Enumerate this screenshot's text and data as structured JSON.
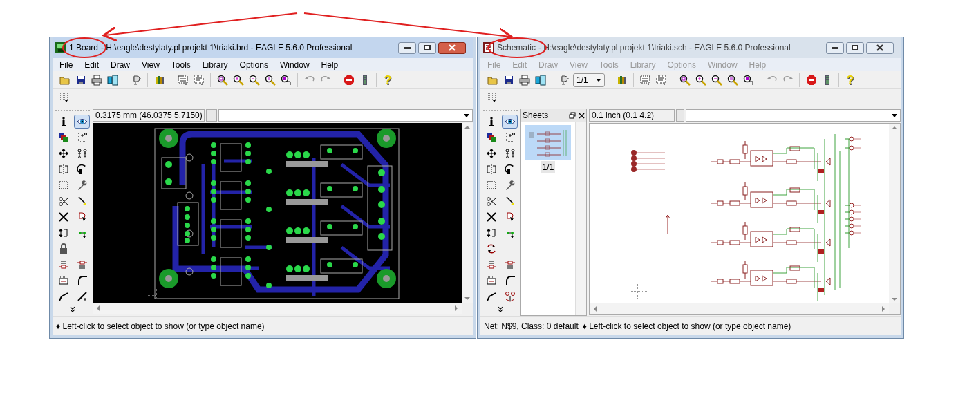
{
  "windows": [
    {
      "kind": "board",
      "active": true,
      "title_prefix": "1 Board",
      "title": "- H:\\eagle\\destylaty.pl projekt 1\\triaki.brd - EAGLE 5.6.0 Professional",
      "menu": [
        {
          "label": "File",
          "disabled": false
        },
        {
          "label": "Edit",
          "disabled": false
        },
        {
          "label": "Draw",
          "disabled": false
        },
        {
          "label": "View",
          "disabled": false
        },
        {
          "label": "Tools",
          "disabled": false
        },
        {
          "label": "Library",
          "disabled": false
        },
        {
          "label": "Options",
          "disabled": false
        },
        {
          "label": "Window",
          "disabled": false
        },
        {
          "label": "Help",
          "disabled": false
        }
      ],
      "toolbar": [
        {
          "kind": "open"
        },
        {
          "kind": "save"
        },
        {
          "kind": "print"
        },
        {
          "kind": "cam"
        },
        {
          "kind": "separator"
        },
        {
          "kind": "switch"
        },
        {
          "kind": "separator"
        },
        {
          "kind": "library"
        },
        {
          "kind": "separator"
        },
        {
          "kind": "script"
        },
        {
          "kind": "ulp"
        },
        {
          "kind": "separator"
        },
        {
          "kind": "zoomfit"
        },
        {
          "kind": "zoomin"
        },
        {
          "kind": "zoomout"
        },
        {
          "kind": "redraw"
        },
        {
          "kind": "zoomselect"
        },
        {
          "kind": "separator"
        },
        {
          "kind": "undo"
        },
        {
          "kind": "redo"
        },
        {
          "kind": "separator"
        },
        {
          "kind": "stop"
        },
        {
          "kind": "drc"
        },
        {
          "kind": "separator"
        },
        {
          "kind": "help",
          "label": "?"
        }
      ],
      "palette": [
        {
          "kind": "info",
          "selected": false
        },
        {
          "kind": "show",
          "selected": true
        },
        {
          "kind": "layers",
          "selected": false
        },
        {
          "kind": "mark",
          "selected": false
        },
        {
          "kind": "move",
          "selected": false
        },
        {
          "kind": "copy",
          "selected": false
        },
        {
          "kind": "mirror",
          "selected": false
        },
        {
          "kind": "rotate",
          "selected": false
        },
        {
          "kind": "group",
          "selected": false
        },
        {
          "kind": "change",
          "selected": false
        },
        {
          "kind": "cut",
          "selected": false
        },
        {
          "kind": "paste",
          "selected": false
        },
        {
          "kind": "delete",
          "selected": false
        },
        {
          "kind": "add",
          "selected": false
        },
        {
          "kind": "pinswap",
          "selected": false
        },
        {
          "kind": "gateswap",
          "selected": false
        },
        {
          "kind": "lock",
          "selected": false
        },
        {
          "kind": "name",
          "selected": false
        },
        {
          "kind": "value",
          "selected": false
        },
        {
          "kind": "smash",
          "selected": false
        },
        {
          "kind": "miter",
          "selected": false
        },
        {
          "kind": "split",
          "selected": false
        },
        {
          "kind": "route",
          "selected": false
        }
      ],
      "coordinates": "0.3175 mm (46.0375 5.7150)",
      "canvas": {
        "kind": "board"
      },
      "status": "♦ Left-click to select object to show (or type object name)"
    },
    {
      "kind": "schematic",
      "active": false,
      "title_prefix": "Schematic",
      "title": "- H:\\eagle\\destylaty.pl projekt 1\\triaki.sch - EAGLE 5.6.0 Professional",
      "menu": [
        {
          "label": "File",
          "disabled": true
        },
        {
          "label": "Edit",
          "disabled": true
        },
        {
          "label": "Draw",
          "disabled": true
        },
        {
          "label": "View",
          "disabled": true
        },
        {
          "label": "Tools",
          "disabled": true
        },
        {
          "label": "Library",
          "disabled": true
        },
        {
          "label": "Options",
          "disabled": true
        },
        {
          "label": "Window",
          "disabled": true
        },
        {
          "label": "Help",
          "disabled": true
        }
      ],
      "toolbar": [
        {
          "kind": "open"
        },
        {
          "kind": "save"
        },
        {
          "kind": "print"
        },
        {
          "kind": "cam"
        },
        {
          "kind": "separator"
        },
        {
          "kind": "switch"
        },
        {
          "kind": "sheet_select",
          "label": "1/1"
        },
        {
          "kind": "separator"
        },
        {
          "kind": "library"
        },
        {
          "kind": "separator"
        },
        {
          "kind": "script"
        },
        {
          "kind": "ulp"
        },
        {
          "kind": "separator"
        },
        {
          "kind": "zoomfit"
        },
        {
          "kind": "zoomin"
        },
        {
          "kind": "zoomout"
        },
        {
          "kind": "redraw"
        },
        {
          "kind": "zoomselect"
        },
        {
          "kind": "separator"
        },
        {
          "kind": "undo"
        },
        {
          "kind": "redo"
        },
        {
          "kind": "separator"
        },
        {
          "kind": "stop"
        },
        {
          "kind": "drc"
        },
        {
          "kind": "separator"
        },
        {
          "kind": "help",
          "label": "?"
        }
      ],
      "palette": [
        {
          "kind": "info",
          "selected": false
        },
        {
          "kind": "show",
          "selected": true
        },
        {
          "kind": "layers",
          "selected": false
        },
        {
          "kind": "mark",
          "selected": false
        },
        {
          "kind": "move",
          "selected": false
        },
        {
          "kind": "copy",
          "selected": false
        },
        {
          "kind": "mirror",
          "selected": false
        },
        {
          "kind": "rotate",
          "selected": false
        },
        {
          "kind": "group",
          "selected": false
        },
        {
          "kind": "change",
          "selected": false
        },
        {
          "kind": "cut",
          "selected": false
        },
        {
          "kind": "paste",
          "selected": false
        },
        {
          "kind": "delete",
          "selected": false
        },
        {
          "kind": "add",
          "selected": false
        },
        {
          "kind": "pinswap",
          "selected": false
        },
        {
          "kind": "gateswap",
          "selected": false
        },
        {
          "kind": "replace",
          "selected": false
        },
        {
          "kind": "name",
          "selected": false
        },
        {
          "kind": "value",
          "selected": false
        },
        {
          "kind": "smash",
          "selected": false
        },
        {
          "kind": "miter",
          "selected": false
        },
        {
          "kind": "split",
          "selected": false
        },
        {
          "kind": "invoke",
          "selected": false
        }
      ],
      "sheets": {
        "title": "Sheets",
        "items": [
          {
            "label": "1/1",
            "selected": true
          }
        ]
      },
      "coordinates": "0.1 inch (0.1 4.2)",
      "canvas": {
        "kind": "schematic"
      },
      "net_info": "Net: N$9, Class: 0 default",
      "status": "♦ Left-click to select object to show (or type object name)"
    }
  ]
}
